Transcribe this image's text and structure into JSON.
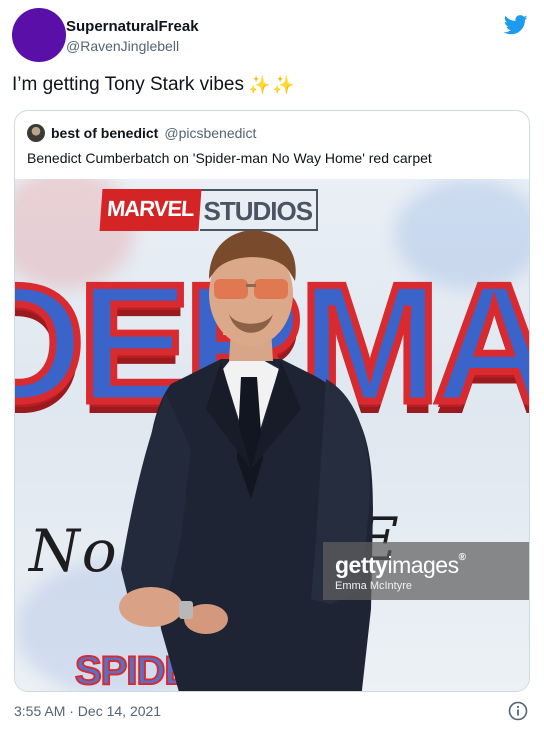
{
  "author": {
    "name": "SupernaturalFreak",
    "handle": "@RavenJinglebell",
    "avatar_color": "#5a0fa8"
  },
  "platform_logo": "twitter-bird-icon",
  "tweet": {
    "text": "I’m getting Tony Stark vibes",
    "emoji": "✨✨",
    "timestamp": "3:55 AM · Dec 14, 2021"
  },
  "quoted_tweet": {
    "author_name": "best of benedict",
    "author_handle": "@picsbenedict",
    "text": "Benedict Cumberbatch on 'Spider-man No Way Home' red carpet",
    "photo": {
      "backdrop_brand_left": "MARVEL",
      "backdrop_brand_right": "STUDIOS",
      "backdrop_title": "DERMAN",
      "backdrop_subtitle": "No Wa",
      "backdrop_subtitle_end": "E",
      "backdrop_bottom": "SPIDER",
      "watermark_brand_bold": "getty",
      "watermark_brand_thin": "images",
      "watermark_reg": "®",
      "watermark_credit": "Emma McIntyre"
    }
  },
  "colors": {
    "twitter_blue": "#1d9bf0",
    "text_primary": "#0f1419",
    "text_secondary": "#536471",
    "border": "#cfd9de",
    "marvel_red": "#d42426"
  }
}
